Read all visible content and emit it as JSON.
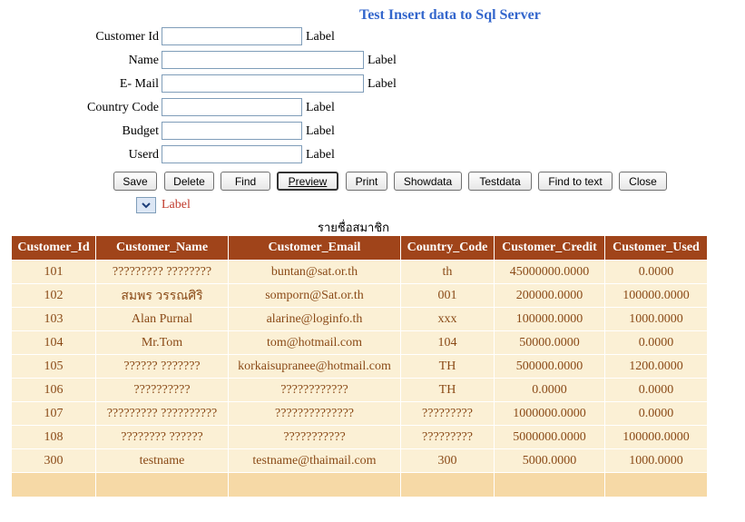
{
  "title": "Test Insert data to Sql Server",
  "form": {
    "customer_id": {
      "label": "Customer Id",
      "value": "",
      "side": "Label"
    },
    "name": {
      "label": "Name",
      "value": "",
      "side": "Label"
    },
    "email": {
      "label": "E- Mail",
      "value": "",
      "side": "Label"
    },
    "country_code": {
      "label": "Country Code",
      "value": "",
      "side": "Label"
    },
    "budget": {
      "label": "Budget",
      "value": "",
      "side": "Label"
    },
    "userd": {
      "label": "Userd",
      "value": "",
      "side": "Label"
    }
  },
  "buttons": [
    "Save",
    "Delete",
    "Find",
    "Preview",
    "Print",
    "Showdata",
    "Testdata",
    "Find to text",
    "Close"
  ],
  "dropdown_label": "Label",
  "table": {
    "caption": "รายชื่อสมาชิก",
    "headers": [
      "Customer_Id",
      "Customer_Name",
      "Customer_Email",
      "Country_Code",
      "Customer_Credit",
      "Customer_Used"
    ],
    "rows": [
      [
        "101",
        "????????? ????????",
        "buntan@sat.or.th",
        "th",
        "45000000.0000",
        "0.0000"
      ],
      [
        "102",
        "สมพร วรรณศิริ",
        "somporn@Sat.or.th",
        "001",
        "200000.0000",
        "100000.0000"
      ],
      [
        "103",
        "Alan Purnal",
        "alarine@loginfo.th",
        "xxx",
        "100000.0000",
        "1000.0000"
      ],
      [
        "104",
        "Mr.Tom",
        "tom@hotmail.com",
        "104",
        "50000.0000",
        "0.0000"
      ],
      [
        "105",
        "?????? ???????",
        "korkaisupranee@hotmail.com",
        "TH",
        "500000.0000",
        "1200.0000"
      ],
      [
        "106",
        "??????????",
        "????????????",
        "TH",
        "0.0000",
        "0.0000"
      ],
      [
        "107",
        "????????? ??????????",
        "??????????????",
        "?????????",
        "1000000.0000",
        "0.0000"
      ],
      [
        "108",
        "???????? ??????",
        "???????????",
        "?????????",
        "5000000.0000",
        "100000.0000"
      ],
      [
        "300",
        "testname",
        "testname@thaimail.com",
        "300",
        "5000.0000",
        "1000.0000"
      ]
    ]
  },
  "colors": {
    "title": "#3366cc",
    "header_bg": "#a0441a",
    "row_bg": "#fbf0d5",
    "cell_text": "#8a4a17",
    "footer_bg": "#f6d9a6",
    "label_red": "#c0392b"
  }
}
